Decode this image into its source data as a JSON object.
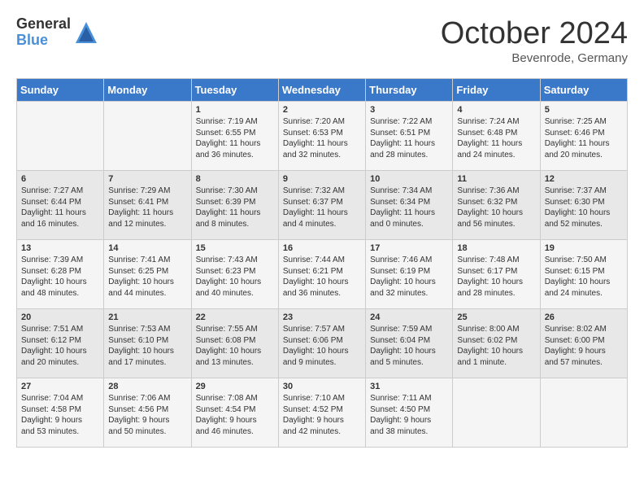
{
  "logo": {
    "general": "General",
    "blue": "Blue"
  },
  "title": "October 2024",
  "location": "Bevenrode, Germany",
  "days_of_week": [
    "Sunday",
    "Monday",
    "Tuesday",
    "Wednesday",
    "Thursday",
    "Friday",
    "Saturday"
  ],
  "weeks": [
    [
      {
        "day": "",
        "info": ""
      },
      {
        "day": "",
        "info": ""
      },
      {
        "day": "1",
        "info": "Sunrise: 7:19 AM\nSunset: 6:55 PM\nDaylight: 11 hours\nand 36 minutes."
      },
      {
        "day": "2",
        "info": "Sunrise: 7:20 AM\nSunset: 6:53 PM\nDaylight: 11 hours\nand 32 minutes."
      },
      {
        "day": "3",
        "info": "Sunrise: 7:22 AM\nSunset: 6:51 PM\nDaylight: 11 hours\nand 28 minutes."
      },
      {
        "day": "4",
        "info": "Sunrise: 7:24 AM\nSunset: 6:48 PM\nDaylight: 11 hours\nand 24 minutes."
      },
      {
        "day": "5",
        "info": "Sunrise: 7:25 AM\nSunset: 6:46 PM\nDaylight: 11 hours\nand 20 minutes."
      }
    ],
    [
      {
        "day": "6",
        "info": "Sunrise: 7:27 AM\nSunset: 6:44 PM\nDaylight: 11 hours\nand 16 minutes."
      },
      {
        "day": "7",
        "info": "Sunrise: 7:29 AM\nSunset: 6:41 PM\nDaylight: 11 hours\nand 12 minutes."
      },
      {
        "day": "8",
        "info": "Sunrise: 7:30 AM\nSunset: 6:39 PM\nDaylight: 11 hours\nand 8 minutes."
      },
      {
        "day": "9",
        "info": "Sunrise: 7:32 AM\nSunset: 6:37 PM\nDaylight: 11 hours\nand 4 minutes."
      },
      {
        "day": "10",
        "info": "Sunrise: 7:34 AM\nSunset: 6:34 PM\nDaylight: 11 hours\nand 0 minutes."
      },
      {
        "day": "11",
        "info": "Sunrise: 7:36 AM\nSunset: 6:32 PM\nDaylight: 10 hours\nand 56 minutes."
      },
      {
        "day": "12",
        "info": "Sunrise: 7:37 AM\nSunset: 6:30 PM\nDaylight: 10 hours\nand 52 minutes."
      }
    ],
    [
      {
        "day": "13",
        "info": "Sunrise: 7:39 AM\nSunset: 6:28 PM\nDaylight: 10 hours\nand 48 minutes."
      },
      {
        "day": "14",
        "info": "Sunrise: 7:41 AM\nSunset: 6:25 PM\nDaylight: 10 hours\nand 44 minutes."
      },
      {
        "day": "15",
        "info": "Sunrise: 7:43 AM\nSunset: 6:23 PM\nDaylight: 10 hours\nand 40 minutes."
      },
      {
        "day": "16",
        "info": "Sunrise: 7:44 AM\nSunset: 6:21 PM\nDaylight: 10 hours\nand 36 minutes."
      },
      {
        "day": "17",
        "info": "Sunrise: 7:46 AM\nSunset: 6:19 PM\nDaylight: 10 hours\nand 32 minutes."
      },
      {
        "day": "18",
        "info": "Sunrise: 7:48 AM\nSunset: 6:17 PM\nDaylight: 10 hours\nand 28 minutes."
      },
      {
        "day": "19",
        "info": "Sunrise: 7:50 AM\nSunset: 6:15 PM\nDaylight: 10 hours\nand 24 minutes."
      }
    ],
    [
      {
        "day": "20",
        "info": "Sunrise: 7:51 AM\nSunset: 6:12 PM\nDaylight: 10 hours\nand 20 minutes."
      },
      {
        "day": "21",
        "info": "Sunrise: 7:53 AM\nSunset: 6:10 PM\nDaylight: 10 hours\nand 17 minutes."
      },
      {
        "day": "22",
        "info": "Sunrise: 7:55 AM\nSunset: 6:08 PM\nDaylight: 10 hours\nand 13 minutes."
      },
      {
        "day": "23",
        "info": "Sunrise: 7:57 AM\nSunset: 6:06 PM\nDaylight: 10 hours\nand 9 minutes."
      },
      {
        "day": "24",
        "info": "Sunrise: 7:59 AM\nSunset: 6:04 PM\nDaylight: 10 hours\nand 5 minutes."
      },
      {
        "day": "25",
        "info": "Sunrise: 8:00 AM\nSunset: 6:02 PM\nDaylight: 10 hours\nand 1 minute."
      },
      {
        "day": "26",
        "info": "Sunrise: 8:02 AM\nSunset: 6:00 PM\nDaylight: 9 hours\nand 57 minutes."
      }
    ],
    [
      {
        "day": "27",
        "info": "Sunrise: 7:04 AM\nSunset: 4:58 PM\nDaylight: 9 hours\nand 53 minutes."
      },
      {
        "day": "28",
        "info": "Sunrise: 7:06 AM\nSunset: 4:56 PM\nDaylight: 9 hours\nand 50 minutes."
      },
      {
        "day": "29",
        "info": "Sunrise: 7:08 AM\nSunset: 4:54 PM\nDaylight: 9 hours\nand 46 minutes."
      },
      {
        "day": "30",
        "info": "Sunrise: 7:10 AM\nSunset: 4:52 PM\nDaylight: 9 hours\nand 42 minutes."
      },
      {
        "day": "31",
        "info": "Sunrise: 7:11 AM\nSunset: 4:50 PM\nDaylight: 9 hours\nand 38 minutes."
      },
      {
        "day": "",
        "info": ""
      },
      {
        "day": "",
        "info": ""
      }
    ]
  ]
}
